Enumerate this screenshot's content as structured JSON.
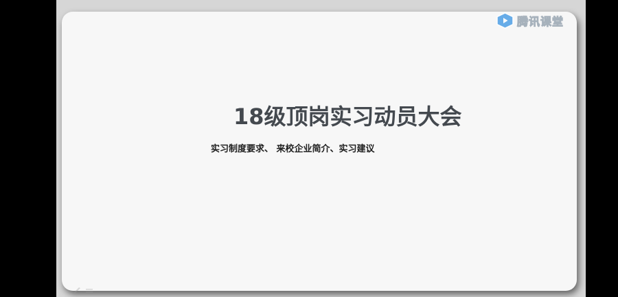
{
  "slide": {
    "title": "18级顶岗实习动员大会",
    "subtitle": "实习制度要求、 来校企业简介、实习建议"
  },
  "watermark": {
    "brand_text": "腾讯课堂",
    "icon": "tencent-classroom-play-icon"
  },
  "colors": {
    "outer_background": "#000000",
    "stage_background": "#d6d6d6",
    "slide_background": "#f7f7f7",
    "title_color": "#44494f",
    "subtitle_color": "#1f1f1f",
    "brand_accent": "#4f9fe6"
  }
}
